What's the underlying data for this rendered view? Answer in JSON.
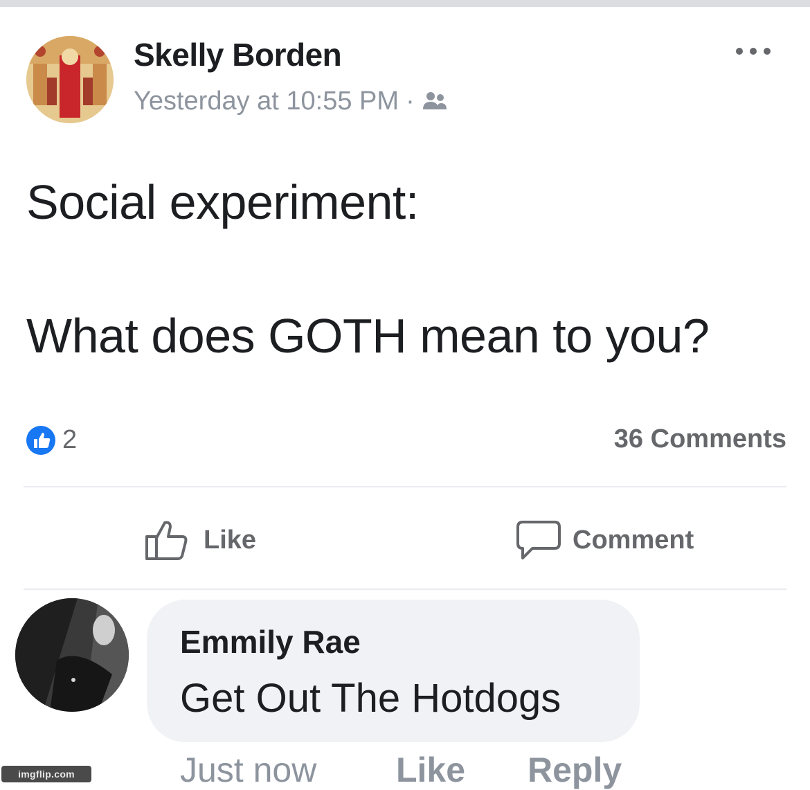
{
  "post": {
    "author": "Skelly Borden",
    "timestamp": "Yesterday at 10:55 PM",
    "separator": "·",
    "audience_icon": "friends-icon",
    "more_icon": "more-options-icon",
    "lines": [
      "Social experiment:",
      "What does GOTH mean to you?"
    ],
    "reactions_count": "2",
    "comments_count": "36 Comments"
  },
  "actions": {
    "like_label": "Like",
    "comment_label": "Comment"
  },
  "comment": {
    "author": "Emmily Rae",
    "text": "Get Out The Hotdogs",
    "time": "Just now",
    "like_label": "Like",
    "reply_label": "Reply"
  },
  "watermark": "imgflip.com",
  "colors": {
    "brand_blue": "#1877f2",
    "muted_text": "#8d949e",
    "bubble": "#f0f2f5"
  }
}
